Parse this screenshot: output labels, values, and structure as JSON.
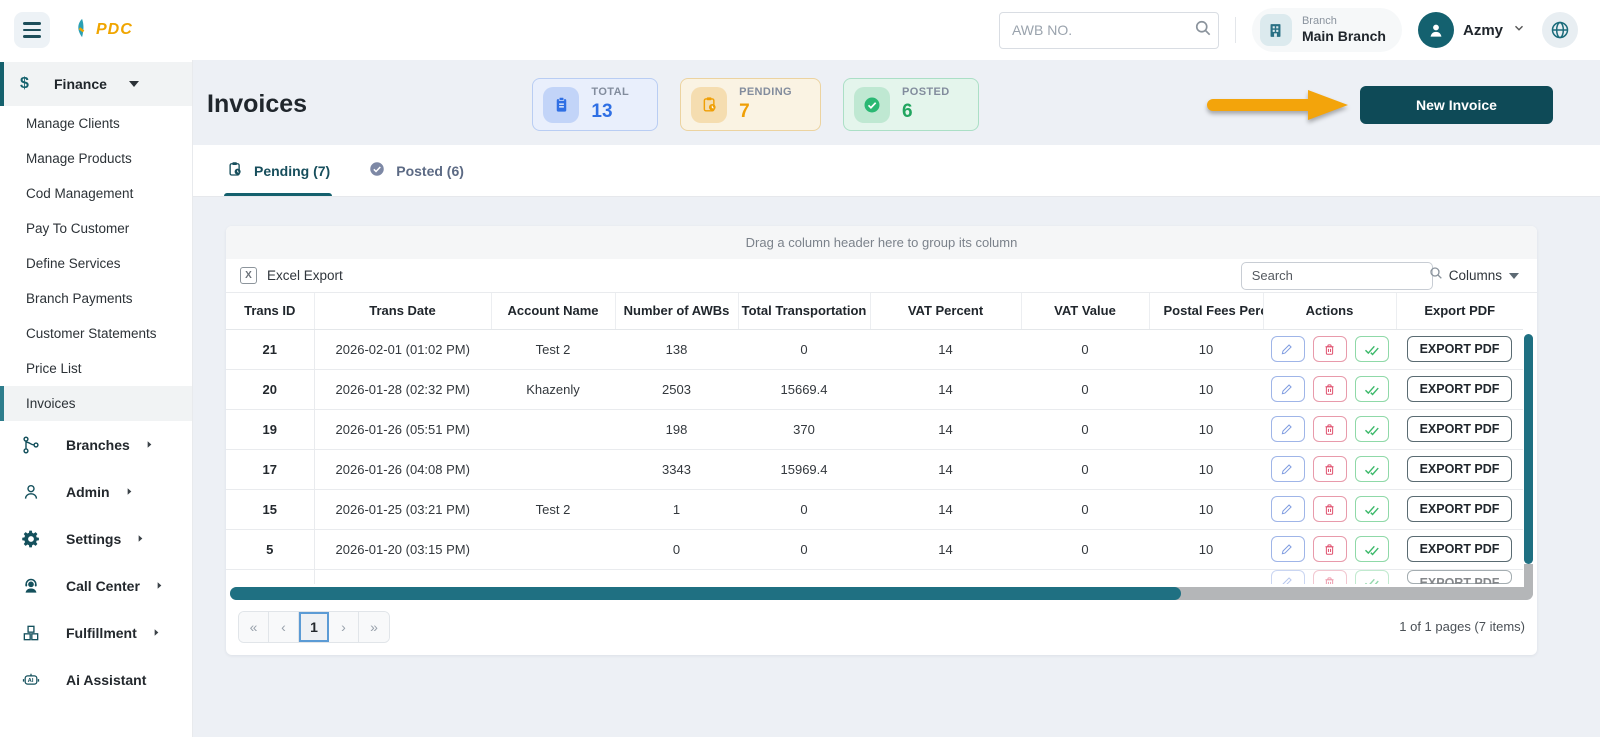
{
  "topbar": {
    "logo_text": "PDC",
    "awb_search_placeholder": "AWB NO.",
    "branch_label": "Branch",
    "branch_name": "Main Branch",
    "user_name": "Azmy"
  },
  "sidebar": {
    "finance_label": "Finance",
    "finance_items": [
      {
        "label": "Manage Clients"
      },
      {
        "label": "Manage Products"
      },
      {
        "label": "Cod Management"
      },
      {
        "label": "Pay To Customer"
      },
      {
        "label": "Define Services"
      },
      {
        "label": "Branch Payments"
      },
      {
        "label": "Customer Statements"
      },
      {
        "label": "Price List"
      },
      {
        "label": "Invoices",
        "active": true
      }
    ],
    "sections": [
      {
        "label": "Branches"
      },
      {
        "label": "Admin"
      },
      {
        "label": "Settings"
      },
      {
        "label": "Call Center"
      },
      {
        "label": "Fulfillment"
      },
      {
        "label": "Ai Assistant"
      }
    ]
  },
  "page": {
    "title": "Invoices",
    "stats": [
      {
        "label": "TOTAL",
        "value": "13"
      },
      {
        "label": "PENDING",
        "value": "7"
      },
      {
        "label": "POSTED",
        "value": "6"
      }
    ],
    "new_invoice_label": "New Invoice",
    "tabs": [
      {
        "label": "Pending (7)",
        "active": true
      },
      {
        "label": "Posted (6)",
        "active": false
      }
    ]
  },
  "table": {
    "group_hint": "Drag a column header here to group its column",
    "excel_export_label": "Excel Export",
    "search_placeholder": "Search",
    "columns_label": "Columns",
    "headers": [
      "Trans ID",
      "Trans Date",
      "Account Name",
      "Number of AWBs",
      "Total Transportation",
      "VAT Percent",
      "VAT Value",
      "Postal Fees Percent",
      "Actions",
      "Export PDF"
    ],
    "export_pdf_label": "EXPORT PDF",
    "rows": [
      {
        "trans_id": "21",
        "trans_date": "2026-02-01 (01:02 PM)",
        "account_name": "Test 2",
        "awbs": "138",
        "total_transportation": "0",
        "vat_percent": "14",
        "vat_value": "0",
        "postal_fees": "10"
      },
      {
        "trans_id": "20",
        "trans_date": "2026-01-28 (02:32 PM)",
        "account_name": "Khazenly",
        "awbs": "2503",
        "total_transportation": "15669.4",
        "vat_percent": "14",
        "vat_value": "0",
        "postal_fees": "10"
      },
      {
        "trans_id": "19",
        "trans_date": "2026-01-26 (05:51 PM)",
        "account_name": "",
        "awbs": "198",
        "total_transportation": "370",
        "vat_percent": "14",
        "vat_value": "0",
        "postal_fees": "10"
      },
      {
        "trans_id": "17",
        "trans_date": "2026-01-26 (04:08 PM)",
        "account_name": "",
        "awbs": "3343",
        "total_transportation": "15969.4",
        "vat_percent": "14",
        "vat_value": "0",
        "postal_fees": "10"
      },
      {
        "trans_id": "15",
        "trans_date": "2026-01-25 (03:21 PM)",
        "account_name": "Test 2",
        "awbs": "1",
        "total_transportation": "0",
        "vat_percent": "14",
        "vat_value": "0",
        "postal_fees": "10"
      },
      {
        "trans_id": "5",
        "trans_date": "2026-01-20 (03:15 PM)",
        "account_name": "",
        "awbs": "0",
        "total_transportation": "0",
        "vat_percent": "14",
        "vat_value": "0",
        "postal_fees": "10"
      }
    ],
    "partial_row_visible": true,
    "pagination": {
      "first": "«",
      "prev": "‹",
      "page": "1",
      "next": "›",
      "last": "»",
      "summary": "1 of 1 pages (7 items)"
    }
  },
  "icons": {
    "menu-icon": "hamburger bars",
    "search-icon": "magnifier",
    "building-icon": "branch building",
    "user-icon": "person silhouette",
    "globe-icon": "language globe",
    "dollar-icon": "$",
    "total-icon": "clipboard",
    "pending-icon": "clipboard-clock",
    "posted-icon": "check-circle",
    "edit-icon": "pencil",
    "delete-icon": "trash",
    "post-icon": "double-check",
    "excel-icon": "boxed X"
  },
  "colors": {
    "primary_teal": "#0e4a57",
    "scrollbar_teal": "#1f7082",
    "annotation_orange": "#f3a40b",
    "total_blue": "#2f6fe4",
    "pending_orange": "#ef9f06",
    "posted_green": "#21a55f",
    "background": "#edf0f5"
  }
}
